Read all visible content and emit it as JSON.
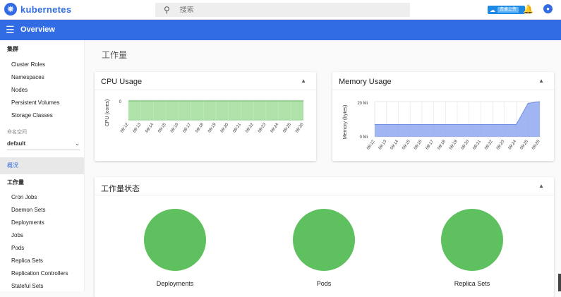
{
  "header": {
    "brand": "kubernetes",
    "search_placeholder": "搜索",
    "upload_badge": "去桌上传"
  },
  "appbar": {
    "title": "Overview"
  },
  "sidebar": {
    "cluster_heading": "集群",
    "cluster_items": [
      "Cluster Roles",
      "Namespaces",
      "Nodes",
      "Persistent Volumes",
      "Storage Classes"
    ],
    "namespace_label": "命名空间",
    "namespace_value": "default",
    "active_item": "概况",
    "workloads_heading": "工作量",
    "workload_items": [
      "Cron Jobs",
      "Daemon Sets",
      "Deployments",
      "Jobs",
      "Pods",
      "Replica Sets",
      "Replication Controllers",
      "Stateful Sets"
    ]
  },
  "main": {
    "page_title": "工作量",
    "cpu_card_title": "CPU Usage",
    "memory_card_title": "Memory Usage",
    "status_card_title": "工作量状态",
    "status_items": [
      "Deployments",
      "Pods",
      "Replica Sets"
    ]
  },
  "colors": {
    "brand": "#326ce5",
    "cpu_fill": "#a5dfa0",
    "mem_fill": "#8fa8ee",
    "status_ok": "#5ec05e"
  },
  "chart_data": [
    {
      "type": "area",
      "title": "CPU Usage",
      "ylabel": "CPU (cores)",
      "x": [
        "09:12",
        "09:13",
        "09:14",
        "09:15",
        "09:16",
        "09:17",
        "09:18",
        "09:19",
        "09:20",
        "09:21",
        "09:22",
        "09:23",
        "09:24",
        "09:25",
        "09:26"
      ],
      "series": [
        {
          "values": [
            0,
            0,
            0,
            0,
            0,
            0,
            0,
            0,
            0,
            0,
            0,
            0,
            0,
            0,
            0
          ]
        }
      ],
      "y_ticks": [
        "0"
      ],
      "grid": true
    },
    {
      "type": "area",
      "title": "Memory Usage",
      "ylabel": "Memory (bytes)",
      "x": [
        "09:12",
        "09:13",
        "09:14",
        "09:15",
        "09:16",
        "09:17",
        "09:18",
        "09:19",
        "09:20",
        "09:21",
        "09:22",
        "09:23",
        "09:24",
        "09:25",
        "09:26"
      ],
      "series": [
        {
          "values": [
            7,
            7,
            7,
            7,
            7,
            7,
            7,
            7,
            7,
            7,
            7,
            7,
            7,
            19,
            20
          ]
        }
      ],
      "y_ticks": [
        "20 Mi",
        "0 Mi"
      ],
      "ylim": [
        0,
        20
      ],
      "grid": true
    }
  ]
}
